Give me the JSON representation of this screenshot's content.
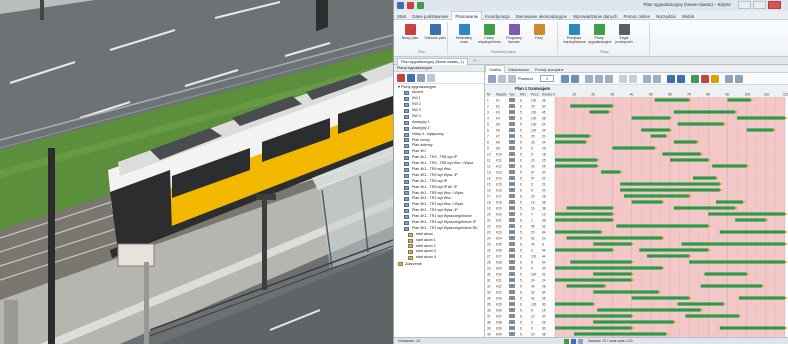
{
  "app": {
    "title": "Plan sygnalizacyjny (Nowe miasto) – Edytor",
    "tabs": [
      "Start",
      "Dane podstawowe",
      "Planowanie",
      "Koordynacja",
      "Sterowanie akomodacyjne",
      "Wprowadzanie danych",
      "Pomoc online",
      "Narzędzia",
      "Widok"
    ],
    "active_tab_index": 2,
    "ribbon": {
      "groups": [
        {
          "label": "Plan",
          "buttons": [
            {
              "label": "Nowy plan",
              "icon": "new-plan-icon",
              "color": "#c94040"
            },
            {
              "label": "Odtwórz plan",
              "icon": "open-plan-icon",
              "color": "#3d6fb0"
            }
          ]
        },
        {
          "label": "Parametry planu",
          "buttons": [
            {
              "label": "Minimalny czas",
              "icon": "min-time-icon",
              "color": "#2e86c1"
            },
            {
              "label": "Czasy międzyzielone",
              "icon": "intergreen-icon",
              "color": "#3f9c4a"
            },
            {
              "label": "Programy fazowe",
              "icon": "phase-programs-icon",
              "color": "#7c5bb0"
            },
            {
              "label": "Fazy",
              "icon": "phases-icon",
              "color": "#d08a2c"
            }
          ]
        },
        {
          "label": "Plany",
          "buttons": [
            {
              "label": "Przejście międzyfazowe",
              "icon": "interstage-icon",
              "color": "#2e86c1"
            },
            {
              "label": "Plany sygnalizacyjne",
              "icon": "signal-plans-icon",
              "color": "#3f9c4a"
            },
            {
              "label": "Zegar przełączeń",
              "icon": "switch-clock-icon",
              "color": "#555f6b"
            }
          ]
        }
      ]
    }
  },
  "document": {
    "tab_title": "Plan sygnalizacyjny (Nowe miasto_1)",
    "sub_tabs": [
      "Grafika",
      "Właściwości",
      "Punkty specjalne"
    ],
    "active_sub_tab_index": 0,
    "toolbar": {
      "przesun_label": "Przesuń",
      "przesun_value": "1"
    }
  },
  "tree": {
    "header": "Plany sygnalizacyjne",
    "root": "Plany sygnalizacyjne",
    "items": [
      "Akcent",
      "KW 1",
      "KW 2",
      "KW 3",
      "KW 4",
      "Awaryjny 1",
      "Awaryjny 2",
      "Nowy 4 - wyłączony",
      "Plan nocny",
      "Plan dzienny",
      "Plan 4KI",
      "Plan 4K1 - TR3 - TR8 wył IP",
      "Plan 4K1 - TR3 - TR8 wył Wsc. i Wysz.",
      "Plan 4K1 - TR5 wył Wsc.",
      "Plan 4K1 - TR5 wył Wysz. IP",
      "Plan 4K1 - TR5 wył IP",
      "Plan 4K1 - TR5 wył IP Ali. IP",
      "Plan 4K1 - TR5 wył Wsc. i Wysz.",
      "Plan 4K1 - TR1 wył Wsc.",
      "Plan 4K1 - TR1 wył Wsc. i Wysz.",
      "Plan 4K1 - TR1 wył Wysz. IP",
      "Plan 4K1 - TR1 wył Wyszczególnione",
      "Plan 4K1 - TR1 wył Wyszczególnione IP",
      "Plan 4K1 - TR1 wył Wyszczególnione RK",
      "start akom",
      "start akom 1",
      "start akom 2",
      "start akom 3",
      "start akom 4"
    ],
    "footer_item": "Zdarzenie"
  },
  "grid": {
    "plan_name": "Plan z tramwajem",
    "columns": [
      "Nr",
      "Nazwa",
      "Typ",
      "Min",
      "Pocz.",
      "Koniec"
    ],
    "timeline_ticks": [
      "0",
      "10",
      "20",
      "30",
      "40",
      "50",
      "60",
      "70",
      "80",
      "90",
      "100",
      "110",
      "120"
    ],
    "colors": {
      "green": "#2f9a45",
      "red_bg": "#f4c7c7",
      "amber": "#e0a000",
      "header": "#eef1f4"
    },
    "rows": [
      {
        "nr": "1",
        "type": "K1",
        "min": "6",
        "a": "100",
        "b": "38",
        "segs": [
          [
            52,
            70
          ],
          [
            90,
            102
          ]
        ]
      },
      {
        "nr": "2",
        "type": "K2",
        "min": "6",
        "a": "25",
        "b": "30",
        "segs": [
          [
            8,
            30
          ]
        ]
      },
      {
        "nr": "3",
        "type": "K3",
        "min": "5",
        "a": "100",
        "b": "45",
        "segs": [
          [
            18,
            28
          ],
          [
            62,
            94
          ]
        ]
      },
      {
        "nr": "4",
        "type": "K4",
        "min": "6",
        "a": "100",
        "b": "38",
        "segs": [
          [
            40,
            60
          ],
          [
            95,
            120
          ]
        ]
      },
      {
        "nr": "5",
        "type": "K5",
        "min": "5",
        "a": "100",
        "b": "24",
        "segs": [
          [
            64,
            88
          ]
        ]
      },
      {
        "nr": "6",
        "type": "K6",
        "min": "5",
        "a": "100",
        "b": "24",
        "segs": [
          [
            45,
            60
          ],
          [
            100,
            114
          ]
        ]
      },
      {
        "nr": "7",
        "type": "K7",
        "min": "5",
        "a": "25",
        "b": "20",
        "segs": [
          [
            0,
            18
          ],
          [
            50,
            58
          ]
        ]
      },
      {
        "nr": "8",
        "type": "K8",
        "min": "5",
        "a": "25",
        "b": "24",
        "segs": [
          [
            0,
            16
          ],
          [
            62,
            74
          ]
        ]
      },
      {
        "nr": "9",
        "type": "K9",
        "min": "5",
        "a": "5",
        "b": "29",
        "segs": [
          [
            30,
            52
          ]
        ]
      },
      {
        "nr": "10",
        "type": "K10",
        "min": "5",
        "a": "5",
        "b": "18",
        "segs": [
          [
            56,
            76
          ]
        ]
      },
      {
        "nr": "11",
        "type": "K11",
        "min": "6",
        "a": "20",
        "b": "25",
        "segs": [
          [
            0,
            22
          ],
          [
            60,
            80
          ]
        ]
      },
      {
        "nr": "12",
        "type": "K12",
        "min": "6",
        "a": "20",
        "b": "25",
        "segs": [
          [
            0,
            22
          ],
          [
            82,
            100
          ]
        ]
      },
      {
        "nr": "13",
        "type": "K13",
        "min": "5",
        "a": "57",
        "b": "20",
        "segs": [
          [
            24,
            34
          ]
        ]
      },
      {
        "nr": "14",
        "type": "K14",
        "min": "5",
        "a": "57",
        "b": "20",
        "segs": [
          [
            72,
            84
          ]
        ]
      },
      {
        "nr": "15",
        "type": "K15",
        "min": "6",
        "a": "5",
        "b": "21",
        "segs": [
          [
            34,
            86
          ]
        ]
      },
      {
        "nr": "16",
        "type": "K16",
        "min": "6",
        "a": "5",
        "b": "20",
        "segs": [
          [
            34,
            86
          ]
        ]
      },
      {
        "nr": "17",
        "type": "K17",
        "min": "6",
        "a": "20",
        "b": "28",
        "segs": [
          [
            36,
            70
          ]
        ]
      },
      {
        "nr": "18",
        "type": "K18",
        "min": "5",
        "a": "16",
        "b": "38",
        "segs": [
          [
            40,
            56
          ],
          [
            84,
            98
          ]
        ]
      },
      {
        "nr": "19",
        "type": "K19",
        "min": "5",
        "a": "16",
        "b": "38",
        "segs": [
          [
            6,
            30
          ],
          [
            62,
            94
          ]
        ]
      },
      {
        "nr": "20",
        "type": "K20",
        "min": "5",
        "a": "7",
        "b": "13",
        "segs": [
          [
            0,
            30
          ],
          [
            80,
            120
          ]
        ]
      },
      {
        "nr": "21",
        "type": "K21",
        "min": "6",
        "a": "1",
        "b": "38",
        "segs": [
          [
            0,
            30
          ],
          [
            94,
            110
          ]
        ]
      },
      {
        "nr": "22",
        "type": "K22",
        "min": "6",
        "a": "65",
        "b": "33",
        "segs": [
          [
            32,
            80
          ]
        ]
      },
      {
        "nr": "23",
        "type": "K23",
        "min": "5",
        "a": "20",
        "b": "84",
        "segs": [
          [
            0,
            24
          ],
          [
            86,
            120
          ]
        ]
      },
      {
        "nr": "24",
        "type": "K24",
        "min": "5",
        "a": "52",
        "b": "20",
        "segs": [
          [
            6,
            56
          ]
        ]
      },
      {
        "nr": "25",
        "type": "K25",
        "min": "6",
        "a": "49",
        "b": "8",
        "segs": [
          [
            20,
            40
          ],
          [
            66,
            120
          ]
        ]
      },
      {
        "nr": "26",
        "type": "K26",
        "min": "5",
        "a": "9",
        "b": "44",
        "segs": [
          [
            0,
            30
          ],
          [
            44,
            80
          ]
        ]
      },
      {
        "nr": "27",
        "type": "K27",
        "min": "6",
        "a": "100",
        "b": "44",
        "segs": [
          [
            48,
            70
          ]
        ]
      },
      {
        "nr": "28",
        "type": "K28",
        "min": "6",
        "a": "5",
        "b": "54",
        "segs": [
          [
            8,
            40
          ],
          [
            70,
            120
          ]
        ]
      },
      {
        "nr": "29",
        "type": "K29",
        "min": "5",
        "a": "4",
        "b": "20",
        "segs": [
          [
            0,
            56
          ]
        ]
      },
      {
        "nr": "30",
        "type": "K30",
        "min": "5",
        "a": "100",
        "b": "20",
        "segs": [
          [
            20,
            40
          ],
          [
            78,
            100
          ]
        ]
      },
      {
        "nr": "31",
        "type": "K31",
        "min": "5",
        "a": "24",
        "b": "24",
        "segs": [
          [
            0,
            40
          ]
        ]
      },
      {
        "nr": "32",
        "type": "K32",
        "min": "5",
        "a": "34",
        "b": "28",
        "segs": [
          [
            6,
            26
          ],
          [
            76,
            108
          ]
        ]
      },
      {
        "nr": "33",
        "type": "K33",
        "min": "6",
        "a": "52",
        "b": "84",
        "segs": [
          [
            20,
            54
          ]
        ]
      },
      {
        "nr": "34",
        "type": "K34",
        "min": "5",
        "a": "41",
        "b": "35",
        "segs": [
          [
            40,
            70
          ],
          [
            96,
            120
          ]
        ]
      },
      {
        "nr": "35",
        "type": "K35",
        "min": "6",
        "a": "100",
        "b": "30",
        "segs": [
          [
            0,
            20
          ],
          [
            64,
            88
          ]
        ]
      },
      {
        "nr": "36",
        "type": "K36",
        "min": "5",
        "a": "8",
        "b": "16",
        "segs": [
          [
            22,
            76
          ]
        ]
      },
      {
        "nr": "37",
        "type": "K37",
        "min": "6",
        "a": "10",
        "b": "20",
        "segs": [
          [
            0,
            40
          ],
          [
            68,
            96
          ]
        ]
      },
      {
        "nr": "38",
        "type": "K38",
        "min": "5",
        "a": "5",
        "b": "26",
        "segs": [
          [
            20,
            62
          ]
        ]
      },
      {
        "nr": "39",
        "type": "K39",
        "min": "6",
        "a": "6",
        "b": "30",
        "segs": [
          [
            0,
            40
          ],
          [
            86,
            120
          ]
        ]
      },
      {
        "nr": "40",
        "type": "K40",
        "min": "5",
        "a": "20",
        "b": "38",
        "segs": [
          [
            10,
            58
          ]
        ]
      }
    ]
  },
  "statusbar": {
    "left": "Gotowość: 14",
    "right": "Zadanie 15 / czas cyklu 120"
  }
}
